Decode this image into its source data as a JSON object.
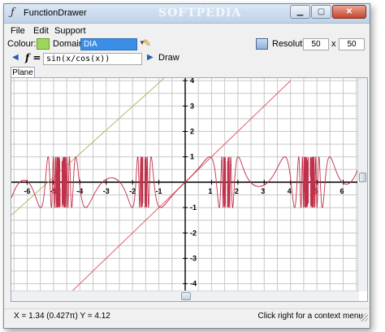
{
  "window": {
    "title": "FunctionDrawer",
    "watermark": "SOFTPEDIA",
    "icon": "italic-f-icon",
    "controls": [
      "minimize",
      "maximize",
      "close"
    ]
  },
  "menu": [
    "File",
    "Edit",
    "Support"
  ],
  "toolbar": {
    "colour_label": "Colour:",
    "colour_value": "#9ed65a",
    "domain_label": "Domain:",
    "domain_value": "DIA",
    "resolution_label": "Resolution:",
    "res_x": "50",
    "res_sep": "x",
    "res_y": "50"
  },
  "function_bar": {
    "f_label": "f =",
    "expression": "sin(x/cos(x))",
    "draw_label": "Draw"
  },
  "tabs": [
    "Plane"
  ],
  "chart_data": {
    "type": "line",
    "title": "",
    "xlabel": "",
    "ylabel": "",
    "xlim": [
      -6.6,
      6.6
    ],
    "ylim": [
      -4.3,
      4.1
    ],
    "grid": true,
    "x_ticks": [
      -6,
      -5,
      -4,
      -3,
      -2,
      -1,
      1,
      2,
      3,
      4,
      5,
      6
    ],
    "y_ticks": [
      4,
      3,
      2,
      1,
      -1,
      -2,
      -3,
      -4
    ],
    "series": [
      {
        "color": "#c0304a",
        "expression": "sin(x/cos(x))"
      },
      {
        "color": "#e06070",
        "x": [
          -4.3,
          4.0
        ],
        "y": [
          -4.3,
          4.0
        ]
      },
      {
        "color": "#b8b46a",
        "x": [
          -6.6,
          -0.8
        ],
        "y": [
          -1.3,
          4.1
        ]
      }
    ]
  },
  "status": {
    "coords": "X = 1.34  (0.427π)      Y = 4.12",
    "hint": "Click right for a context menu"
  }
}
